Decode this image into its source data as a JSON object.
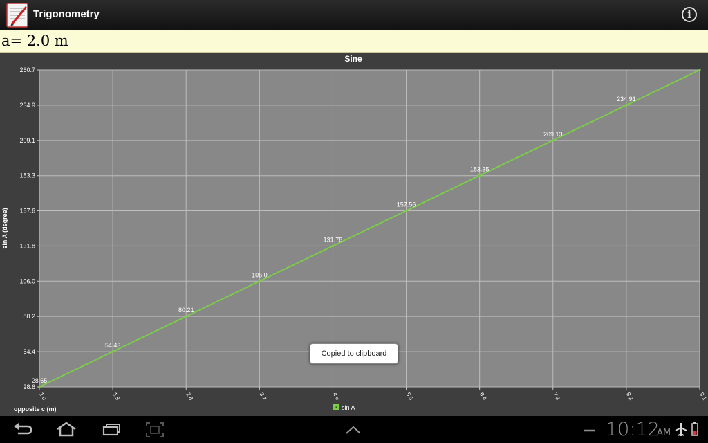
{
  "app": {
    "title": "Trigonometry",
    "info_icon_label": "i"
  },
  "formula": {
    "text": "a= 2.0 m"
  },
  "toast": {
    "text": "Copied to clipboard"
  },
  "status_bar": {
    "time": "10:12",
    "ampm": "AM"
  },
  "colors": {
    "line": "#7ccc4a",
    "plot_bg": "#888888",
    "grid": "#bdbdbd",
    "frame_bg": "#3e3e3e"
  },
  "chart_data": {
    "type": "line",
    "title": "Sine",
    "xlabel": "opposite c (m)",
    "ylabel": "sin A (degree)",
    "x_ticks": [
      "1.0",
      "1.9",
      "2.8",
      "3.7",
      "4.6",
      "5.5",
      "6.4",
      "7.3",
      "8.2",
      "9.1"
    ],
    "y_ticks": [
      "28.6",
      "54.4",
      "80.2",
      "106.0",
      "131.8",
      "157.6",
      "183.3",
      "209.1",
      "234.9",
      "260.7"
    ],
    "xlim": [
      1.0,
      9.1
    ],
    "ylim": [
      28.6,
      260.7
    ],
    "grid": true,
    "legend_position": "bottom-center",
    "series": [
      {
        "name": "sin A",
        "x": [
          1.0,
          1.9,
          2.8,
          3.7,
          4.6,
          5.5,
          6.4,
          7.3,
          8.2,
          9.1
        ],
        "y": [
          28.65,
          54.43,
          80.21,
          106.0,
          131.78,
          157.56,
          183.35,
          209.13,
          234.91,
          260.7
        ],
        "labels": [
          "28.65",
          "54.43",
          "80.21",
          "106.0",
          "131.78",
          "157.56",
          "183.35",
          "209.13",
          "234.91",
          ""
        ]
      }
    ]
  }
}
